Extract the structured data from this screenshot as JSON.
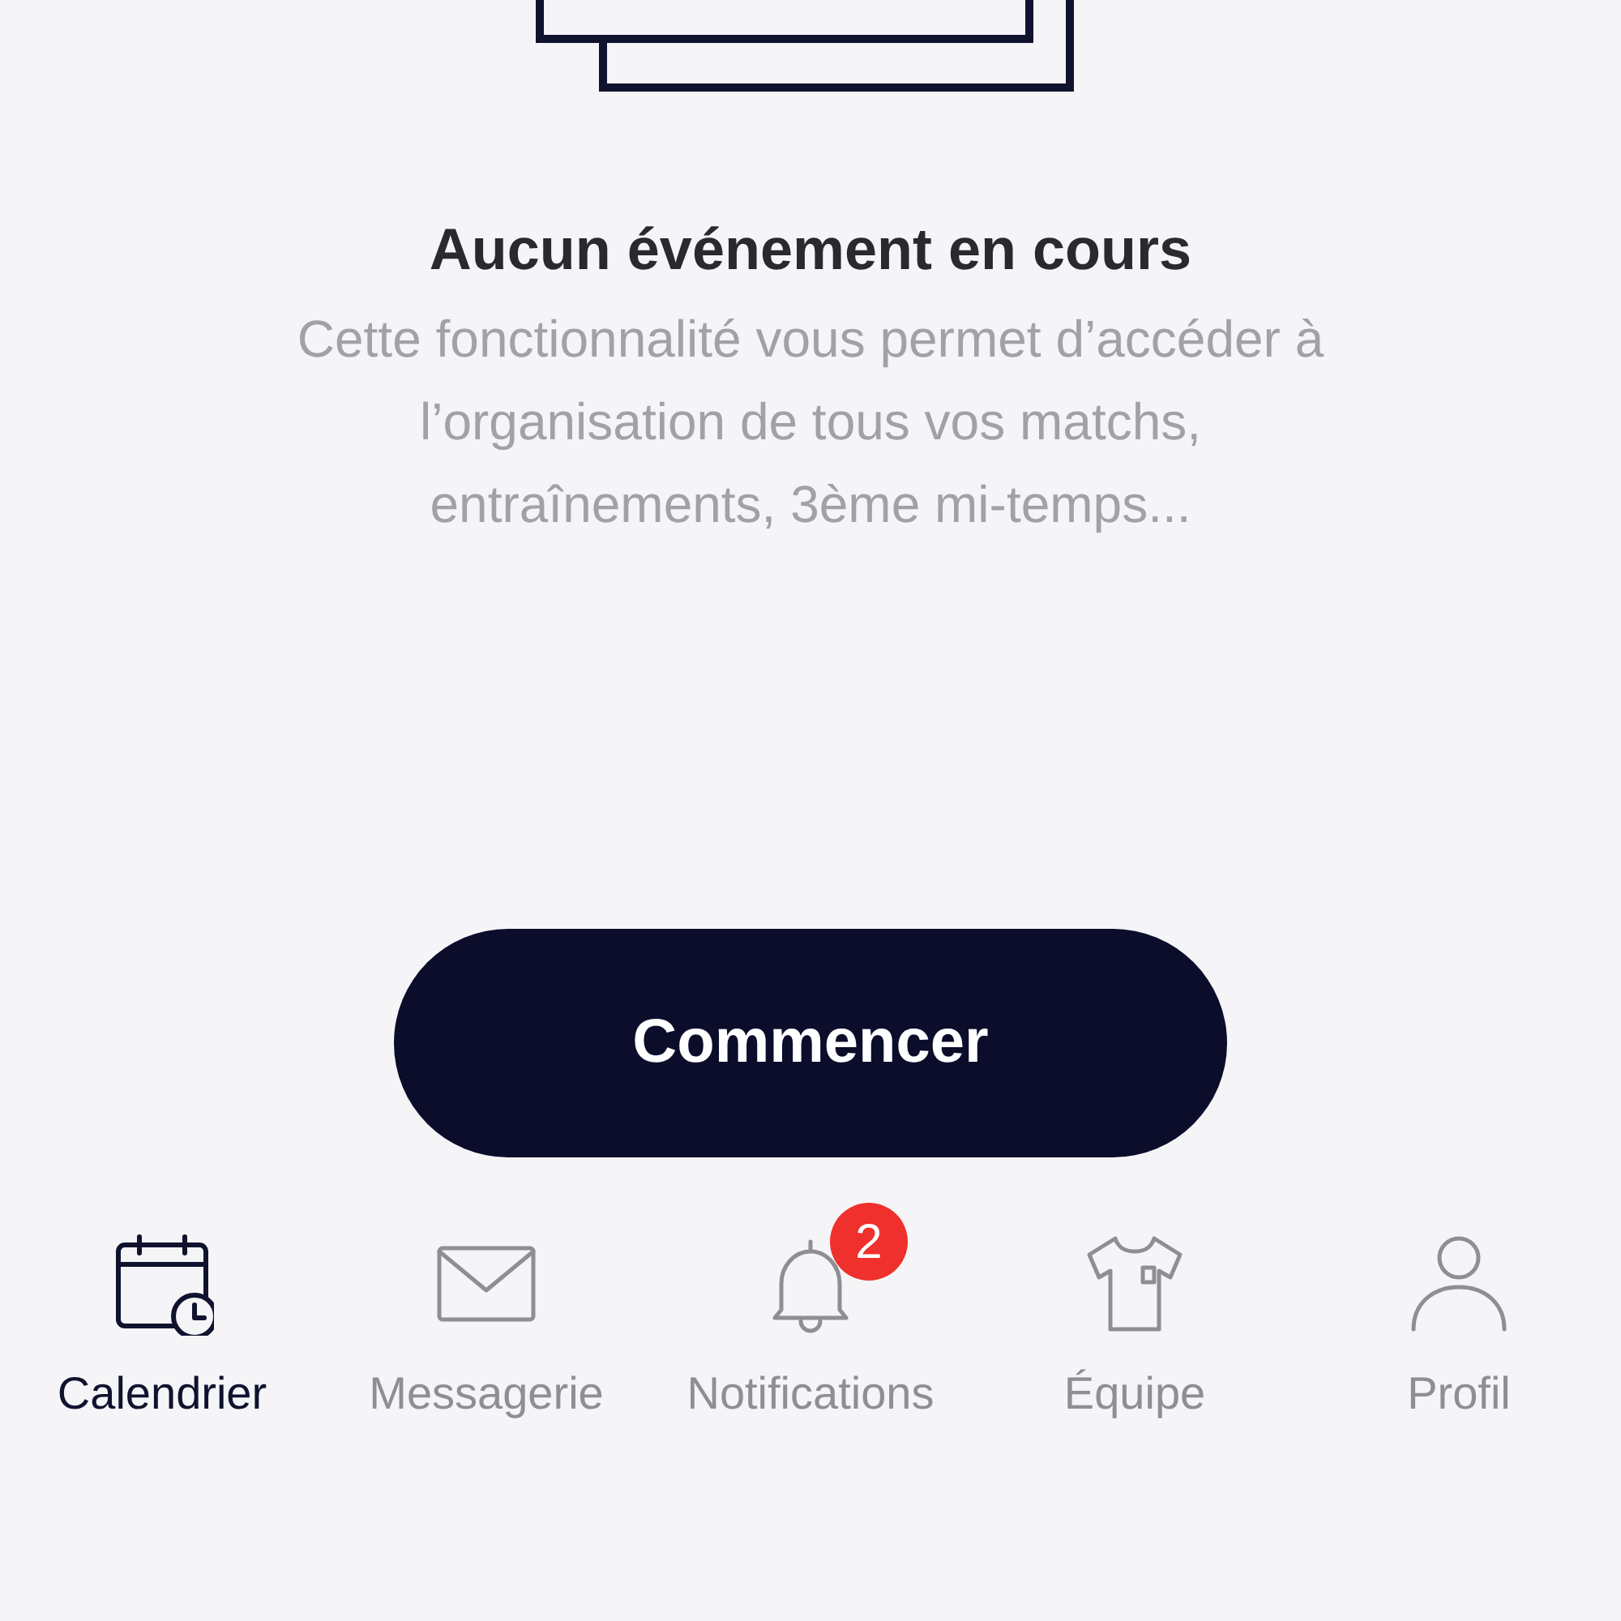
{
  "empty_state": {
    "title": "Aucun événement en cours",
    "description": "Cette fonctionnalité vous permet d’accéder à l’organisation de tous vos matchs, entraînements, 3ème mi-temps..."
  },
  "start_button": {
    "label": "Commencer"
  },
  "tab_bar": [
    {
      "kind": "calendar",
      "label": "Calendrier",
      "selected": true
    },
    {
      "kind": "mail",
      "label": "Messagerie",
      "selected": false
    },
    {
      "kind": "bell",
      "label": "Notifications",
      "selected": false,
      "badge": "2"
    },
    {
      "kind": "shirt",
      "label": "Équipe",
      "selected": false
    },
    {
      "kind": "person",
      "label": "Profil",
      "selected": false
    }
  ]
}
